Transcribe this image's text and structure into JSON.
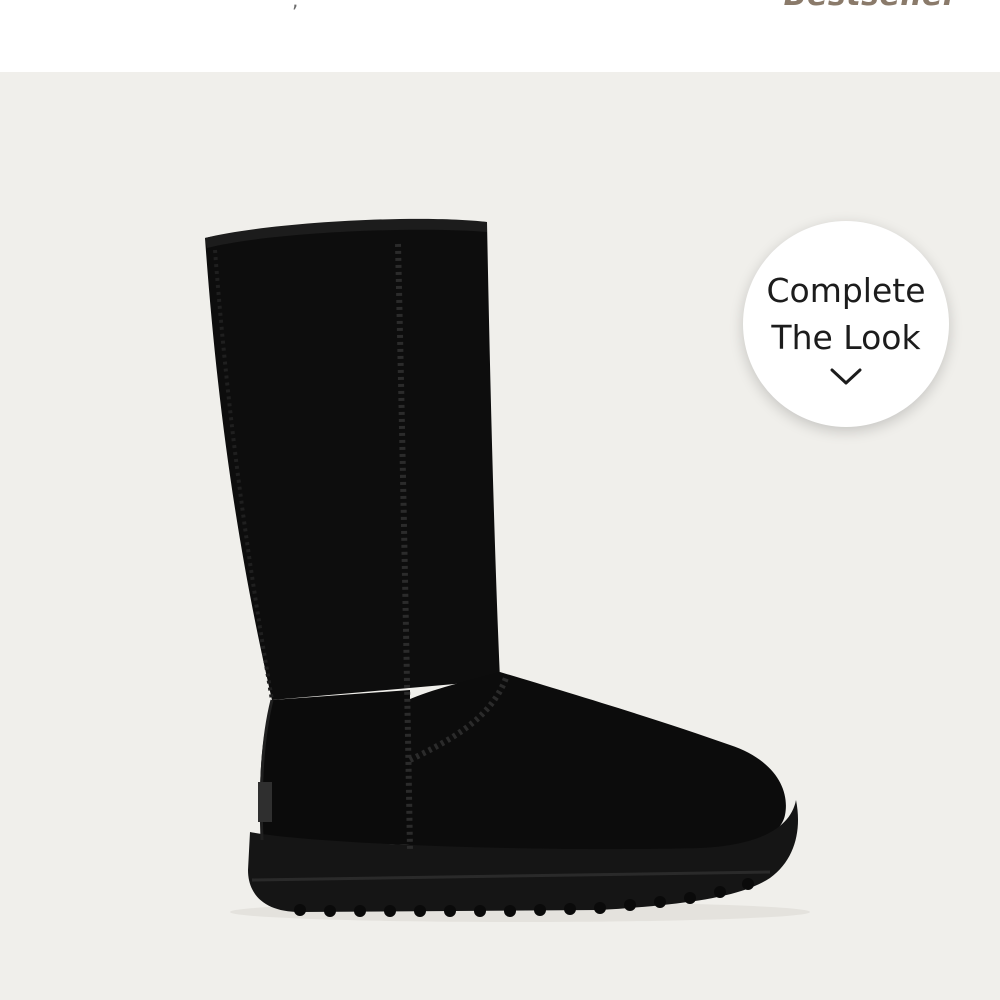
{
  "header": {
    "badge_text": "Bestseller",
    "left_fragment": ", "
  },
  "product": {
    "image_alt": "Black tall sheepskin boot",
    "background_color": "#f0efeb",
    "boot_color": "#0b0b0b"
  },
  "complete_look": {
    "line1": "Complete",
    "line2": "The Look",
    "icon": "chevron-down-icon"
  }
}
